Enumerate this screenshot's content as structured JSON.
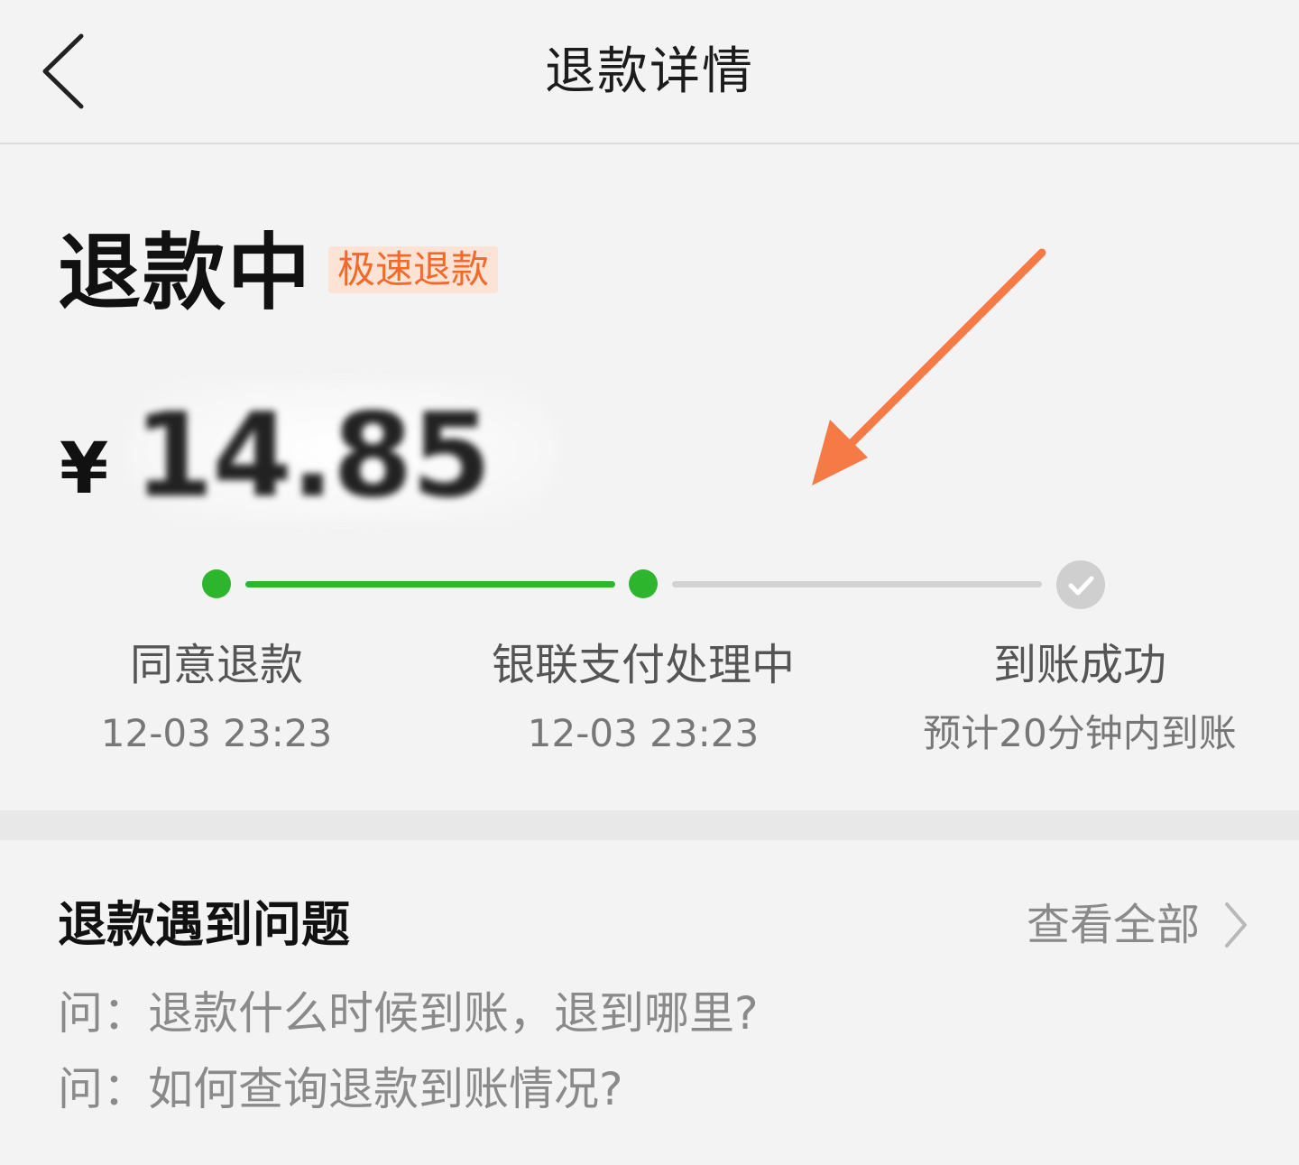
{
  "header": {
    "title": "退款详情",
    "back_icon": "chevron-left-icon"
  },
  "status": {
    "title": "退款中",
    "badge": "极速退款",
    "currency": "¥",
    "amount": "14.85",
    "badge_bg": "#fde3d6",
    "badge_color": "#f26a2a"
  },
  "progress": {
    "active_color": "#2db52d",
    "inactive_color": "#d2d2d2",
    "completed_steps": 2,
    "steps": [
      {
        "label": "同意退款",
        "sub": "12-03 23:23",
        "state": "done"
      },
      {
        "label": "银联支付处理中",
        "sub": "12-03 23:23",
        "state": "done"
      },
      {
        "label": "到账成功",
        "sub": "预计20分钟内到账",
        "state": "pending",
        "icon": "check-circle-icon"
      }
    ]
  },
  "faq": {
    "title": "退款遇到问题",
    "view_all": "查看全部",
    "view_all_icon": "chevron-right-icon",
    "items": [
      {
        "text": "问：退款什么时候到账，退到哪里?"
      },
      {
        "text": "问：如何查询退款到账情况?"
      }
    ]
  },
  "annotation": {
    "arrow_color": "#f57a45",
    "icon": "arrow-annotation-icon"
  }
}
